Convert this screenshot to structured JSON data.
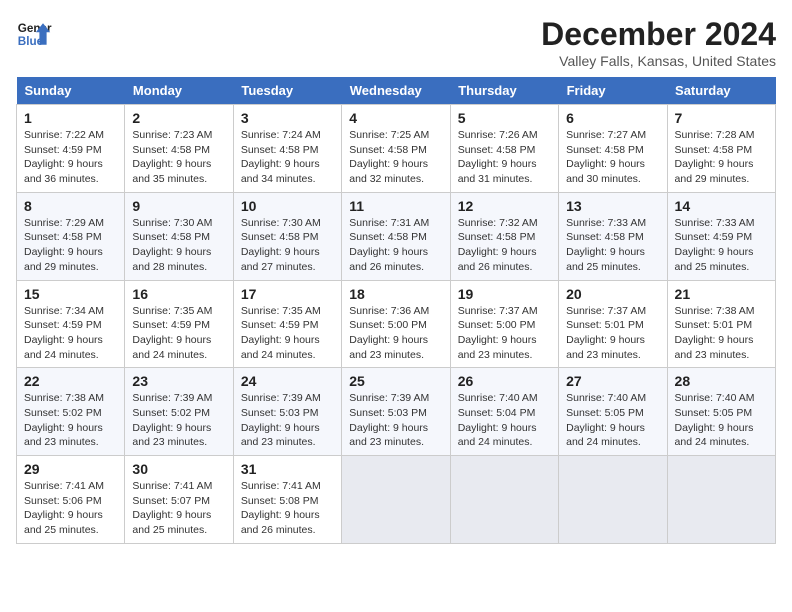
{
  "header": {
    "logo_line1": "General",
    "logo_line2": "Blue",
    "month": "December 2024",
    "location": "Valley Falls, Kansas, United States"
  },
  "days_of_week": [
    "Sunday",
    "Monday",
    "Tuesday",
    "Wednesday",
    "Thursday",
    "Friday",
    "Saturday"
  ],
  "weeks": [
    [
      {
        "day": 1,
        "info": "Sunrise: 7:22 AM\nSunset: 4:59 PM\nDaylight: 9 hours\nand 36 minutes."
      },
      {
        "day": 2,
        "info": "Sunrise: 7:23 AM\nSunset: 4:58 PM\nDaylight: 9 hours\nand 35 minutes."
      },
      {
        "day": 3,
        "info": "Sunrise: 7:24 AM\nSunset: 4:58 PM\nDaylight: 9 hours\nand 34 minutes."
      },
      {
        "day": 4,
        "info": "Sunrise: 7:25 AM\nSunset: 4:58 PM\nDaylight: 9 hours\nand 32 minutes."
      },
      {
        "day": 5,
        "info": "Sunrise: 7:26 AM\nSunset: 4:58 PM\nDaylight: 9 hours\nand 31 minutes."
      },
      {
        "day": 6,
        "info": "Sunrise: 7:27 AM\nSunset: 4:58 PM\nDaylight: 9 hours\nand 30 minutes."
      },
      {
        "day": 7,
        "info": "Sunrise: 7:28 AM\nSunset: 4:58 PM\nDaylight: 9 hours\nand 29 minutes."
      }
    ],
    [
      {
        "day": 8,
        "info": "Sunrise: 7:29 AM\nSunset: 4:58 PM\nDaylight: 9 hours\nand 29 minutes."
      },
      {
        "day": 9,
        "info": "Sunrise: 7:30 AM\nSunset: 4:58 PM\nDaylight: 9 hours\nand 28 minutes."
      },
      {
        "day": 10,
        "info": "Sunrise: 7:30 AM\nSunset: 4:58 PM\nDaylight: 9 hours\nand 27 minutes."
      },
      {
        "day": 11,
        "info": "Sunrise: 7:31 AM\nSunset: 4:58 PM\nDaylight: 9 hours\nand 26 minutes."
      },
      {
        "day": 12,
        "info": "Sunrise: 7:32 AM\nSunset: 4:58 PM\nDaylight: 9 hours\nand 26 minutes."
      },
      {
        "day": 13,
        "info": "Sunrise: 7:33 AM\nSunset: 4:58 PM\nDaylight: 9 hours\nand 25 minutes."
      },
      {
        "day": 14,
        "info": "Sunrise: 7:33 AM\nSunset: 4:59 PM\nDaylight: 9 hours\nand 25 minutes."
      }
    ],
    [
      {
        "day": 15,
        "info": "Sunrise: 7:34 AM\nSunset: 4:59 PM\nDaylight: 9 hours\nand 24 minutes."
      },
      {
        "day": 16,
        "info": "Sunrise: 7:35 AM\nSunset: 4:59 PM\nDaylight: 9 hours\nand 24 minutes."
      },
      {
        "day": 17,
        "info": "Sunrise: 7:35 AM\nSunset: 4:59 PM\nDaylight: 9 hours\nand 24 minutes."
      },
      {
        "day": 18,
        "info": "Sunrise: 7:36 AM\nSunset: 5:00 PM\nDaylight: 9 hours\nand 23 minutes."
      },
      {
        "day": 19,
        "info": "Sunrise: 7:37 AM\nSunset: 5:00 PM\nDaylight: 9 hours\nand 23 minutes."
      },
      {
        "day": 20,
        "info": "Sunrise: 7:37 AM\nSunset: 5:01 PM\nDaylight: 9 hours\nand 23 minutes."
      },
      {
        "day": 21,
        "info": "Sunrise: 7:38 AM\nSunset: 5:01 PM\nDaylight: 9 hours\nand 23 minutes."
      }
    ],
    [
      {
        "day": 22,
        "info": "Sunrise: 7:38 AM\nSunset: 5:02 PM\nDaylight: 9 hours\nand 23 minutes."
      },
      {
        "day": 23,
        "info": "Sunrise: 7:39 AM\nSunset: 5:02 PM\nDaylight: 9 hours\nand 23 minutes."
      },
      {
        "day": 24,
        "info": "Sunrise: 7:39 AM\nSunset: 5:03 PM\nDaylight: 9 hours\nand 23 minutes."
      },
      {
        "day": 25,
        "info": "Sunrise: 7:39 AM\nSunset: 5:03 PM\nDaylight: 9 hours\nand 23 minutes."
      },
      {
        "day": 26,
        "info": "Sunrise: 7:40 AM\nSunset: 5:04 PM\nDaylight: 9 hours\nand 24 minutes."
      },
      {
        "day": 27,
        "info": "Sunrise: 7:40 AM\nSunset: 5:05 PM\nDaylight: 9 hours\nand 24 minutes."
      },
      {
        "day": 28,
        "info": "Sunrise: 7:40 AM\nSunset: 5:05 PM\nDaylight: 9 hours\nand 24 minutes."
      }
    ],
    [
      {
        "day": 29,
        "info": "Sunrise: 7:41 AM\nSunset: 5:06 PM\nDaylight: 9 hours\nand 25 minutes."
      },
      {
        "day": 30,
        "info": "Sunrise: 7:41 AM\nSunset: 5:07 PM\nDaylight: 9 hours\nand 25 minutes."
      },
      {
        "day": 31,
        "info": "Sunrise: 7:41 AM\nSunset: 5:08 PM\nDaylight: 9 hours\nand 26 minutes."
      },
      null,
      null,
      null,
      null
    ]
  ]
}
